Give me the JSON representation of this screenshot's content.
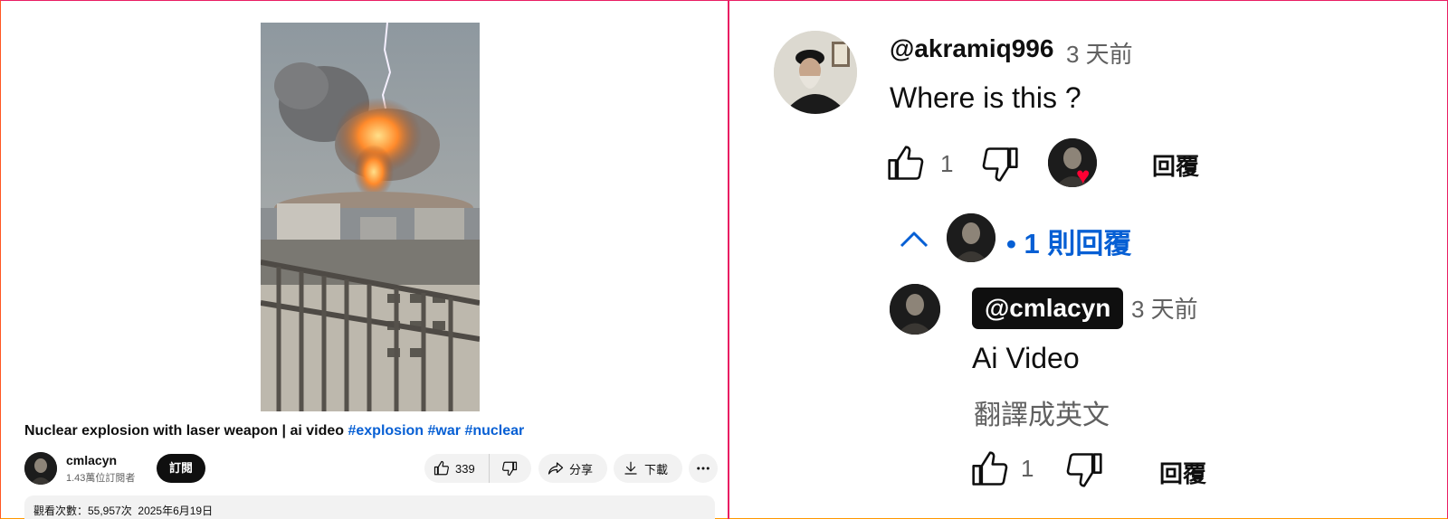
{
  "video": {
    "title": "Nuclear explosion with laser weapon | ai video",
    "hashtags": [
      "#explosion",
      "#war",
      "#nuclear"
    ]
  },
  "channel": {
    "name": "cmlacyn",
    "subscribers": "1.43萬位訂閱者",
    "subscribe_label": "訂閱"
  },
  "actions": {
    "like_count": "339",
    "share_label": "分享",
    "download_label": "下載"
  },
  "description": {
    "views": "觀看次數：55,957次",
    "date": "2025年6月19日"
  },
  "comment": {
    "author": "@akramiq996",
    "time": "3 天前",
    "text": "Where is this ?",
    "like_count": "1",
    "reply_label": "回覆",
    "replies_toggle": "• 1 則回覆"
  },
  "reply": {
    "author": "@cmlacyn",
    "time": "3 天前",
    "text": "Ai Video",
    "translate_label": "翻譯成英文",
    "like_count": "1",
    "reply_label": "回覆"
  },
  "colors": {
    "link_blue": "#065fd4",
    "heart_red": "#ff0033",
    "frame_pink": "#e91e63"
  }
}
